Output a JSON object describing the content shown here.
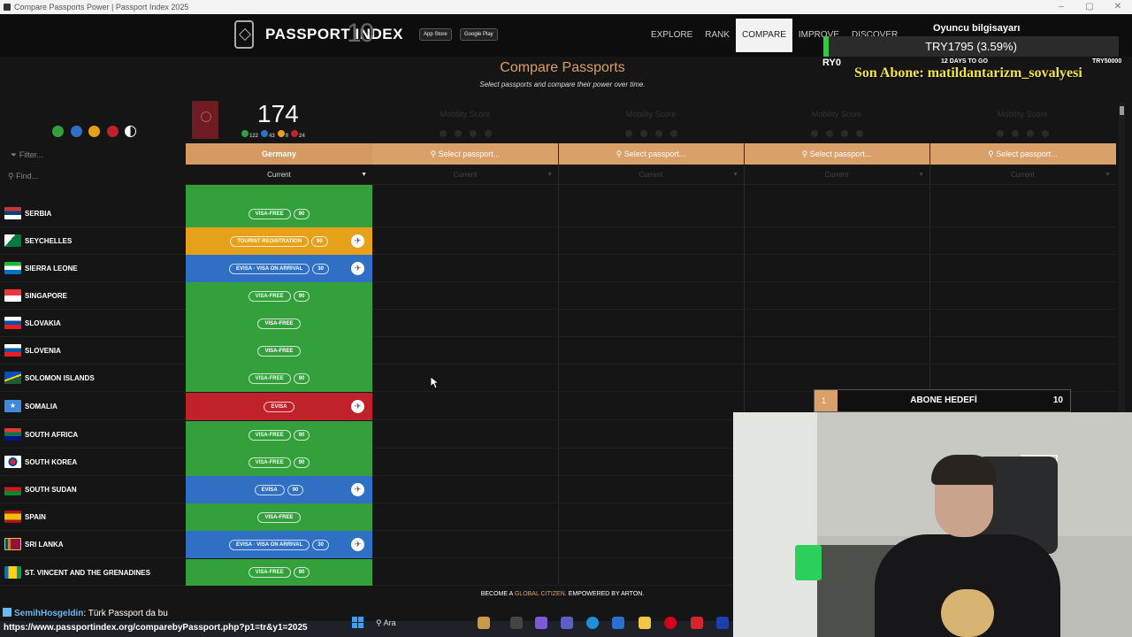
{
  "window": {
    "title": "Compare Passports Power | Passport Index 2025"
  },
  "header": {
    "brand": "PASSPORT INDEX",
    "brand_mark": "10",
    "app_store": "App Store",
    "google_play": "Google Play",
    "nav": [
      "EXPLORE",
      "RANK",
      "COMPARE",
      "IMPROVE",
      "DISCOVER"
    ]
  },
  "page": {
    "title": "Compare Passports",
    "subtitle": "Select passports and compare their power over time."
  },
  "filters": {
    "filter_placeholder": "Filter...",
    "find_placeholder": "Find..."
  },
  "colors": {
    "visa_free": "#34a03c",
    "tourist_registration": "#e6a11a",
    "evisa_arrival": "#2f6fc4",
    "evisa": "#c0212b",
    "accent": "#d9a06a"
  },
  "passport": {
    "country": "Germany",
    "score": "174",
    "counts": [
      "122",
      "43",
      "9",
      "24"
    ],
    "time": "Current"
  },
  "compare_slots": [
    {
      "mobility": "Mobility Score",
      "select": "Select passport...",
      "time": "Current"
    },
    {
      "mobility": "Mobility Score",
      "select": "Select passport...",
      "time": "Current"
    },
    {
      "mobility": "Mobility Score",
      "select": "Select passport...",
      "time": "Current"
    },
    {
      "mobility": "Mobility Score",
      "select": "Select passport...",
      "time": "Current"
    }
  ],
  "rows": [
    {
      "country": "SERBIA",
      "status": "visa_free",
      "label": "VISA-FREE",
      "days": "90",
      "plane": false
    },
    {
      "country": "SEYCHELLES",
      "status": "tourist_registration",
      "label": "TOURIST REGISTRATION",
      "days": "90",
      "plane": true
    },
    {
      "country": "SIERRA LEONE",
      "status": "evisa_arrival",
      "label": "EVISA · VISA ON ARRIVAL",
      "days": "30",
      "plane": true
    },
    {
      "country": "SINGAPORE",
      "status": "visa_free",
      "label": "VISA-FREE",
      "days": "90",
      "plane": false
    },
    {
      "country": "SLOVAKIA",
      "status": "visa_free",
      "label": "VISA-FREE",
      "days": "",
      "plane": false
    },
    {
      "country": "SLOVENIA",
      "status": "visa_free",
      "label": "VISA-FREE",
      "days": "",
      "plane": false
    },
    {
      "country": "SOLOMON ISLANDS",
      "status": "visa_free",
      "label": "VISA-FREE",
      "days": "90",
      "plane": false
    },
    {
      "country": "SOMALIA",
      "status": "evisa",
      "label": "EVISA",
      "days": "",
      "plane": true
    },
    {
      "country": "SOUTH AFRICA",
      "status": "visa_free",
      "label": "VISA-FREE",
      "days": "90",
      "plane": false
    },
    {
      "country": "SOUTH KOREA",
      "status": "visa_free",
      "label": "VISA-FREE",
      "days": "90",
      "plane": false
    },
    {
      "country": "SOUTH SUDAN",
      "status": "evisa_arrival",
      "label": "EVISA",
      "days": "90",
      "plane": true
    },
    {
      "country": "SPAIN",
      "status": "visa_free",
      "label": "VISA-FREE",
      "days": "",
      "plane": false
    },
    {
      "country": "SRI LANKA",
      "status": "evisa_arrival",
      "label": "EVISA · VISA ON ARRIVAL",
      "days": "30",
      "plane": true
    },
    {
      "country": "ST. VINCENT AND THE GRENADINES",
      "status": "visa_free",
      "label": "VISA-FREE",
      "days": "90",
      "plane": false
    }
  ],
  "footer": {
    "part1": "BECOME A",
    "highlight": "GLOBAL CITIZEN.",
    "part2": "EMPOWERED BY",
    "brand": "ARTON."
  },
  "overlay": {
    "title": "Oyuncu bilgisayarı",
    "amount": "TRY1795 (3.59%)",
    "start": "RY0",
    "days_left": "12 DAYS TO GO",
    "target": "TRY50000",
    "last_sub": "Son Abone: matildantarizm_sovalyesi",
    "goal_index": "1",
    "goal_label": "ABONE HEDEFİ",
    "goal_value": "10"
  },
  "taskbar": {
    "chat_user": "SemihHosgeldin",
    "chat_msg": ": Türk Passport da bu",
    "status_url": "https://www.passportindex.org/comparebyPassport.php?p1=tr&y1=2025",
    "search": "Ara"
  }
}
